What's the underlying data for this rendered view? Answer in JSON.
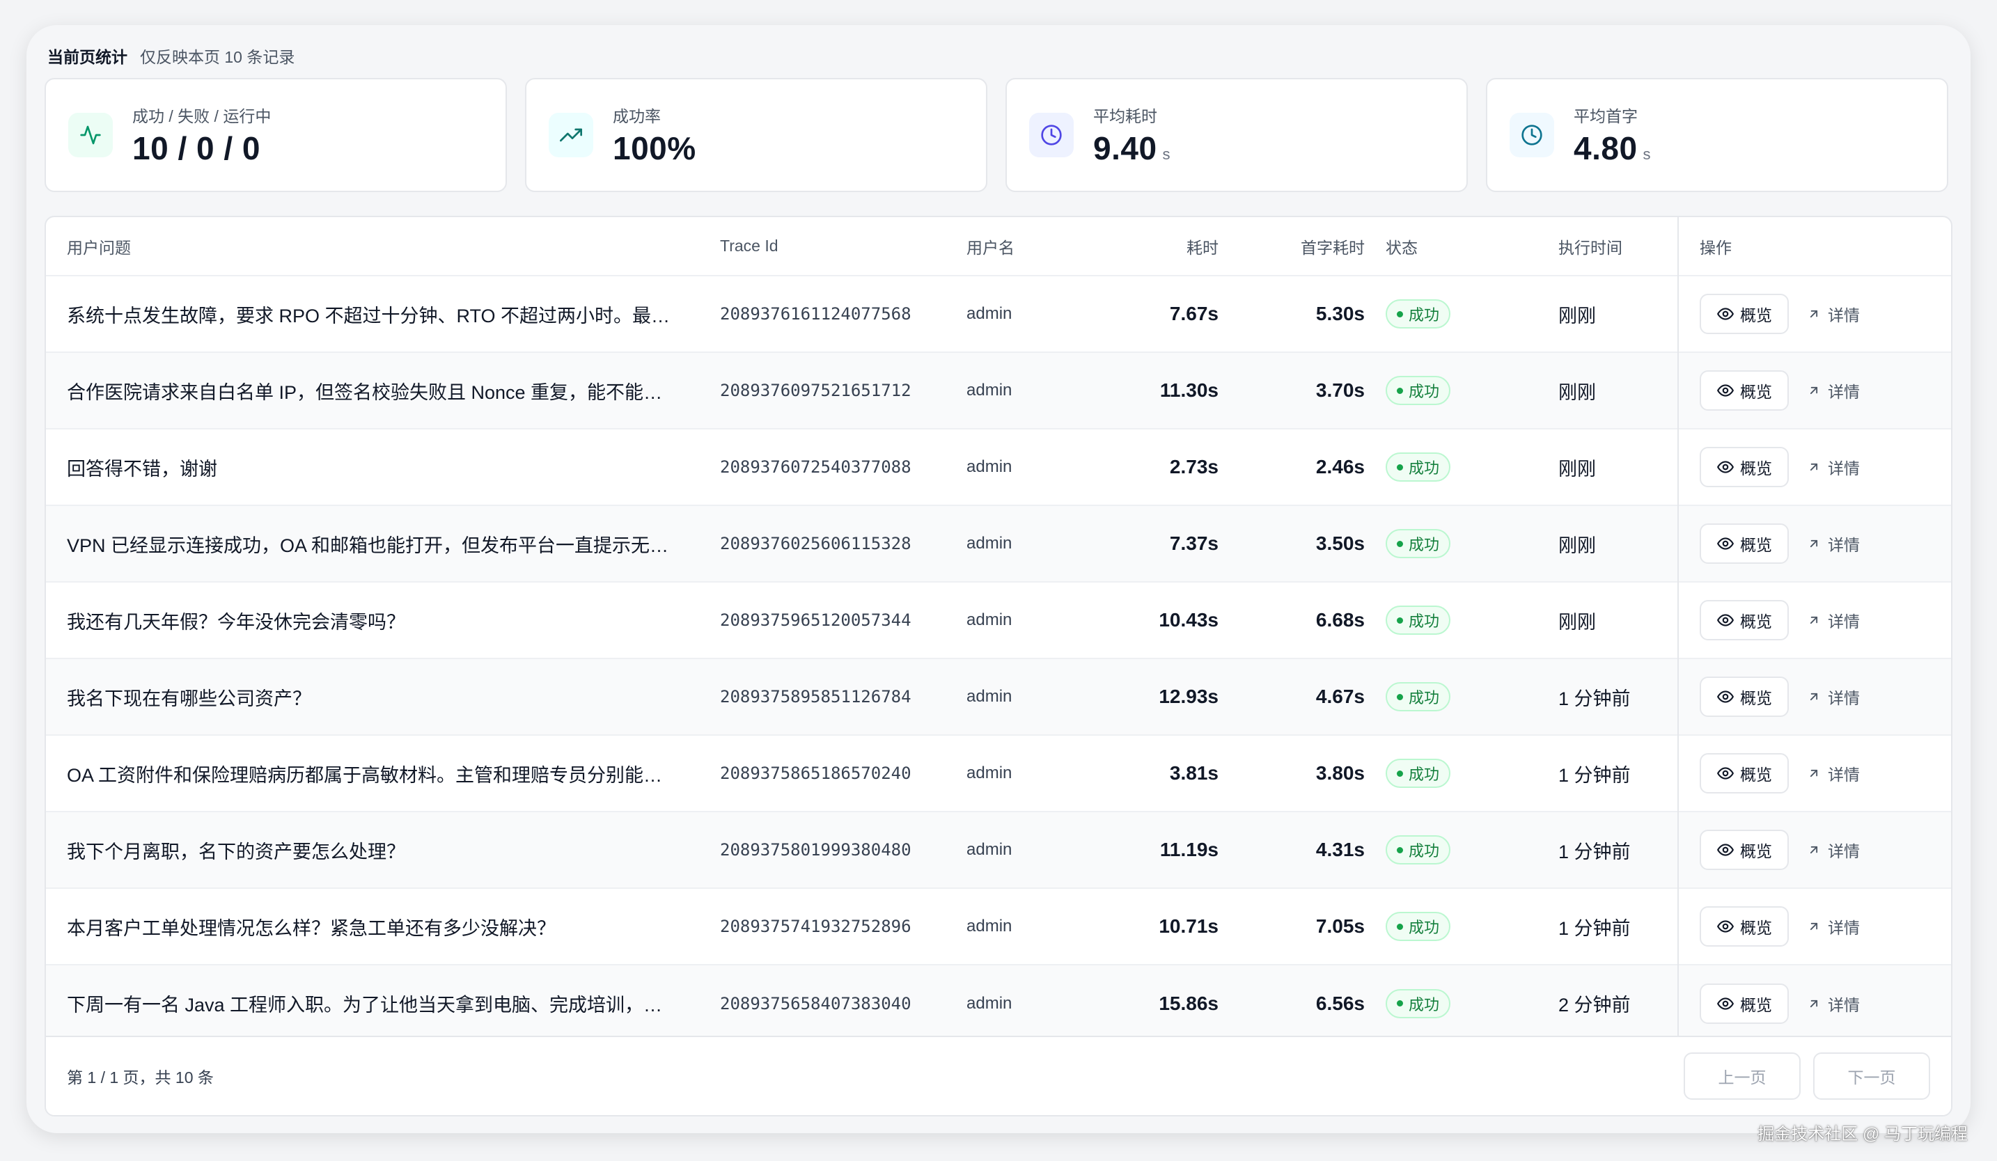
{
  "stats_header": {
    "title": "当前页统计",
    "hint": "仅反映本页 10 条记录"
  },
  "cards": [
    {
      "icon": "activity-icon",
      "label": "成功 / 失败 / 运行中",
      "value": "10 / 0 / 0",
      "unit": "",
      "icon_bg": "#ecfdf5",
      "icon_color": "#059669"
    },
    {
      "icon": "trending-up-icon",
      "label": "成功率",
      "value": "100%",
      "unit": "",
      "icon_bg": "#ecfeff",
      "icon_color": "#0f766e"
    },
    {
      "icon": "clock-icon",
      "label": "平均耗时",
      "value": "9.40",
      "unit": "s",
      "icon_bg": "#eef2ff",
      "icon_color": "#4f46e5"
    },
    {
      "icon": "clock-icon",
      "label": "平均首字",
      "value": "4.80",
      "unit": "s",
      "icon_bg": "#f0f9ff",
      "icon_color": "#0e7490"
    }
  ],
  "table": {
    "headers": {
      "question": "用户问题",
      "trace_id": "Trace Id",
      "username": "用户名",
      "duration": "耗时",
      "first_token": "首字耗时",
      "status": "状态",
      "exec_time": "执行时间",
      "ops": "操作"
    },
    "overview_label": "概览",
    "detail_label": "详情",
    "rows": [
      {
        "question": "系统十点发生故障，要求 RPO 不超过十分钟、RTO 不超过两小时。最终应当如何处理",
        "trace_id": "2089376161124077568",
        "username": "admin",
        "duration": "7.67s",
        "first_token": "5.30s",
        "status": "成功",
        "exec_time": "刚刚"
      },
      {
        "question": "合作医院请求来自白名单 IP，但签名校验失败且 Nonce 重复，能不能放行",
        "trace_id": "2089376097521651712",
        "username": "admin",
        "duration": "11.30s",
        "first_token": "3.70s",
        "status": "成功",
        "exec_time": "刚刚"
      },
      {
        "question": "回答得不错，谢谢",
        "trace_id": "2089376072540377088",
        "username": "admin",
        "duration": "2.73s",
        "first_token": "2.46s",
        "status": "成功",
        "exec_time": "刚刚"
      },
      {
        "question": "VPN 已经显示连接成功，OA 和邮箱也能打开，但发布平台一直提示无权限访问",
        "trace_id": "2089376025606115328",
        "username": "admin",
        "duration": "7.37s",
        "first_token": "3.50s",
        "status": "成功",
        "exec_time": "刚刚"
      },
      {
        "question": "我还有几天年假？今年没休完会清零吗？",
        "trace_id": "2089375965120057344",
        "username": "admin",
        "duration": "10.43s",
        "first_token": "6.68s",
        "status": "成功",
        "exec_time": "刚刚"
      },
      {
        "question": "我名下现在有哪些公司资产？",
        "trace_id": "2089375895851126784",
        "username": "admin",
        "duration": "12.93s",
        "first_token": "4.67s",
        "status": "成功",
        "exec_time": "1 分钟前"
      },
      {
        "question": "OA 工资附件和保险理赔病历都属于高敏材料。主管和理赔专员分别能否查看",
        "trace_id": "2089375865186570240",
        "username": "admin",
        "duration": "3.81s",
        "first_token": "3.80s",
        "status": "成功",
        "exec_time": "1 分钟前"
      },
      {
        "question": "我下个月离职，名下的资产要怎么处理？",
        "trace_id": "2089375801999380480",
        "username": "admin",
        "duration": "11.19s",
        "first_token": "4.31s",
        "status": "成功",
        "exec_time": "1 分钟前"
      },
      {
        "question": "本月客户工单处理情况怎么样？紧急工单还有多少没解决？",
        "trace_id": "2089375741932752896",
        "username": "admin",
        "duration": "10.71s",
        "first_token": "7.05s",
        "status": "成功",
        "exec_time": "1 分钟前"
      },
      {
        "question": "下周一有一名 Java 工程师入职。为了让他当天拿到电脑、完成培训，需要提前做什么",
        "trace_id": "2089375658407383040",
        "username": "admin",
        "duration": "15.86s",
        "first_token": "6.56s",
        "status": "成功",
        "exec_time": "2 分钟前"
      }
    ]
  },
  "footer": {
    "page_info": "第 1 / 1 页，共 10 条",
    "prev_label": "上一页",
    "next_label": "下一页"
  },
  "watermark": "掘金技术社区 @ 马丁玩编程",
  "colors": {
    "success": "#16a34a",
    "border": "#e5e7eb"
  }
}
